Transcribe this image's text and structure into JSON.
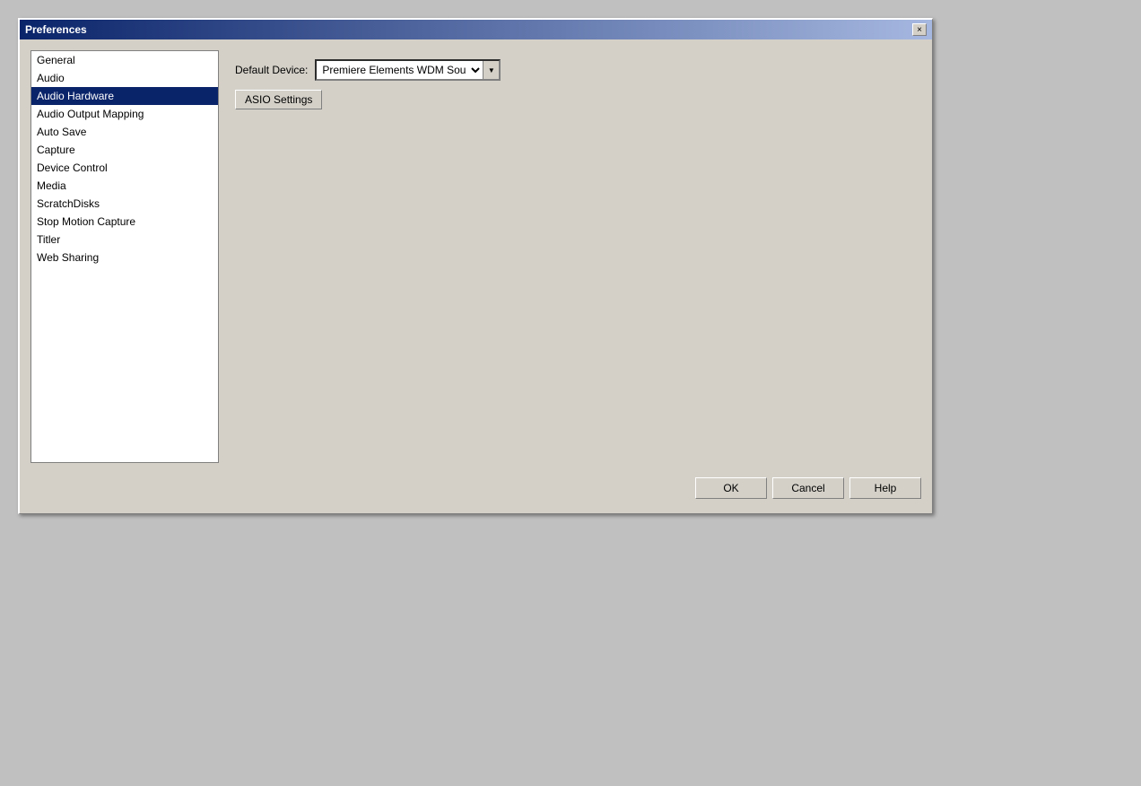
{
  "dialog": {
    "title": "Preferences",
    "close_button": "×"
  },
  "sidebar": {
    "items": [
      {
        "label": "General",
        "active": false
      },
      {
        "label": "Audio",
        "active": false
      },
      {
        "label": "Audio Hardware",
        "active": true
      },
      {
        "label": "Audio Output Mapping",
        "active": false
      },
      {
        "label": "Auto Save",
        "active": false
      },
      {
        "label": "Capture",
        "active": false
      },
      {
        "label": "Device Control",
        "active": false
      },
      {
        "label": "Media",
        "active": false
      },
      {
        "label": "ScratchDisks",
        "active": false
      },
      {
        "label": "Stop Motion Capture",
        "active": false
      },
      {
        "label": "Titler",
        "active": false
      },
      {
        "label": "Web Sharing",
        "active": false
      }
    ]
  },
  "content": {
    "default_device_label": "Default Device:",
    "default_device_value": "Premiere Elements WDM Sound",
    "asio_settings_label": "ASIO Settings",
    "dropdown_options": [
      "Premiere Elements WDM Sound"
    ]
  },
  "footer": {
    "ok_label": "OK",
    "cancel_label": "Cancel",
    "help_label": "Help"
  }
}
